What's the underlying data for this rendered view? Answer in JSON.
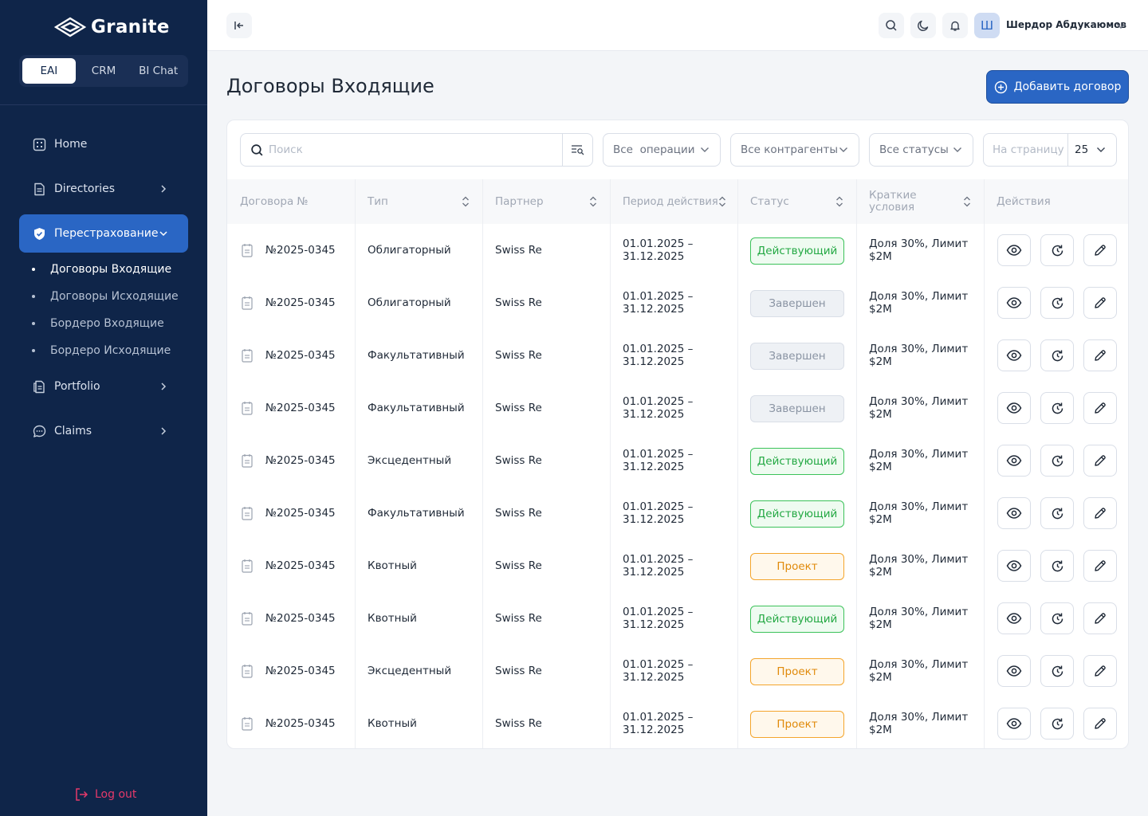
{
  "app": {
    "name": "Granite"
  },
  "app_switch": [
    {
      "label": "EAI",
      "active": true
    },
    {
      "label": "CRM",
      "active": false
    },
    {
      "label": "BI Chat",
      "active": false
    }
  ],
  "nav": {
    "home": "Home",
    "directories": "Directories",
    "reinsurance": "Перестрахование",
    "portfolio": "Portfolio",
    "claims": "Claims",
    "sub": [
      "Договоры Входящие",
      "Договоры Исходящие",
      "Бордеро Входящие",
      "Бордеро Исходящие"
    ]
  },
  "logout": "Log out",
  "user": {
    "initial": "Ш",
    "name": "Шердор Абдукаюмов"
  },
  "page": {
    "title": "Договоры Входящие",
    "add_button": "Добавить договор"
  },
  "filters": {
    "search_placeholder": "Поиск",
    "operations": "Все  операции",
    "counterparties": "Все контрагенты",
    "statuses": "Все статусы",
    "per_page_label": "На страницу",
    "per_page_value": "25"
  },
  "table": {
    "headers": {
      "number": "Договора №",
      "type": "Тип",
      "partner": "Партнер",
      "period": "Период действия",
      "status": "Статус",
      "terms_1": "Краткие",
      "terms_2": "условия",
      "actions": "Действия"
    },
    "rows": [
      {
        "number": "№2025-0345",
        "type": "Облигаторный",
        "partner": "Swiss Re",
        "period_1": "01.01.2025 –",
        "period_2": "31.12.2025",
        "status": "Действующий",
        "status_kind": "active",
        "terms_1": "Доля 30%, Лимит",
        "terms_2": "$2M"
      },
      {
        "number": "№2025-0345",
        "type": "Облигаторный",
        "partner": "Swiss Re",
        "period_1": "01.01.2025 –",
        "period_2": "31.12.2025",
        "status": "Завершен",
        "status_kind": "done",
        "terms_1": "Доля 30%, Лимит",
        "terms_2": "$2M"
      },
      {
        "number": "№2025-0345",
        "type": "Факультативный",
        "partner": "Swiss Re",
        "period_1": "01.01.2025 –",
        "period_2": "31.12.2025",
        "status": "Завершен",
        "status_kind": "done",
        "terms_1": "Доля 30%, Лимит",
        "terms_2": "$2M"
      },
      {
        "number": "№2025-0345",
        "type": "Факультативный",
        "partner": "Swiss Re",
        "period_1": "01.01.2025 –",
        "period_2": "31.12.2025",
        "status": "Завершен",
        "status_kind": "done",
        "terms_1": "Доля 30%, Лимит",
        "terms_2": "$2M"
      },
      {
        "number": "№2025-0345",
        "type": "Эксцедентный",
        "partner": "Swiss Re",
        "period_1": "01.01.2025 –",
        "period_2": "31.12.2025",
        "status": "Действующий",
        "status_kind": "active",
        "terms_1": "Доля 30%, Лимит",
        "terms_2": "$2M"
      },
      {
        "number": "№2025-0345",
        "type": "Факультативный",
        "partner": "Swiss Re",
        "period_1": "01.01.2025 –",
        "period_2": "31.12.2025",
        "status": "Действующий",
        "status_kind": "active",
        "terms_1": "Доля 30%, Лимит",
        "terms_2": "$2M"
      },
      {
        "number": "№2025-0345",
        "type": "Квотный",
        "partner": "Swiss Re",
        "period_1": "01.01.2025 –",
        "period_2": "31.12.2025",
        "status": "Проект",
        "status_kind": "project",
        "terms_1": "Доля 30%, Лимит",
        "terms_2": "$2M"
      },
      {
        "number": "№2025-0345",
        "type": "Квотный",
        "partner": "Swiss Re",
        "period_1": "01.01.2025 –",
        "period_2": "31.12.2025",
        "status": "Действующий",
        "status_kind": "active",
        "terms_1": "Доля 30%, Лимит",
        "terms_2": "$2M"
      },
      {
        "number": "№2025-0345",
        "type": "Эксцедентный",
        "partner": "Swiss Re",
        "period_1": "01.01.2025 –",
        "period_2": "31.12.2025",
        "status": "Проект",
        "status_kind": "project",
        "terms_1": "Доля 30%, Лимит",
        "terms_2": "$2M"
      },
      {
        "number": "№2025-0345",
        "type": "Квотный",
        "partner": "Swiss Re",
        "period_1": "01.01.2025 –",
        "period_2": "31.12.2025",
        "status": "Проект",
        "status_kind": "project",
        "terms_1": "Доля 30%, Лимит",
        "terms_2": "$2M"
      }
    ]
  },
  "colors": {
    "sidebar": "#0f2549",
    "accent": "#2a66c4",
    "active": "#23a843",
    "project": "#e08a0b",
    "done": "#8a94a3",
    "logout": "#e5396a"
  }
}
